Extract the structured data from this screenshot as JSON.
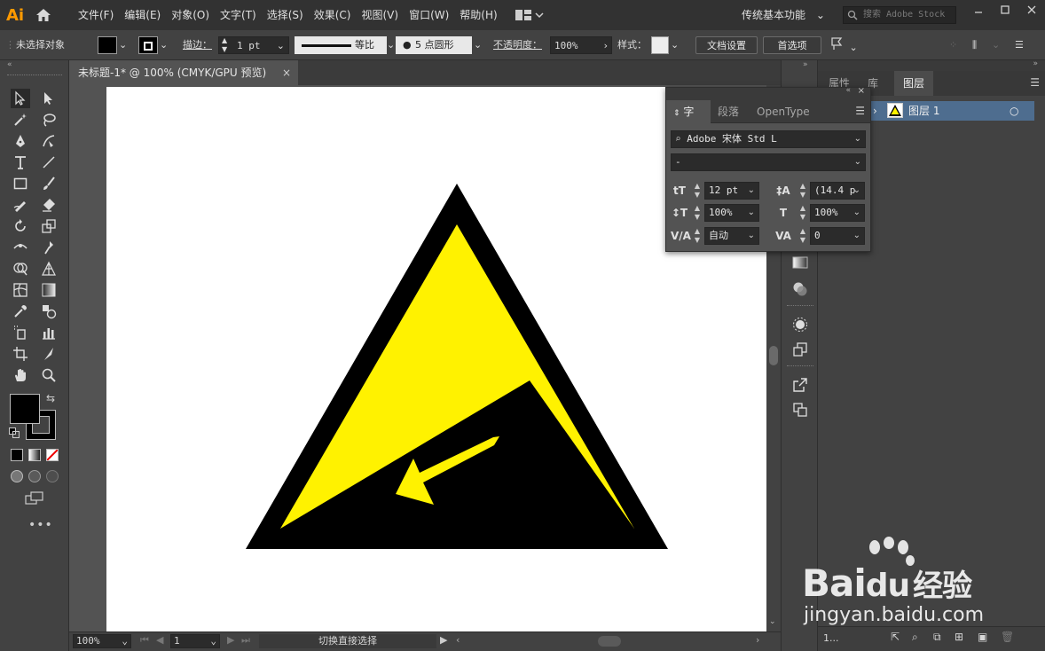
{
  "app": {
    "logo": "Ai",
    "icon_home": "home-icon"
  },
  "menu": [
    "文件(F)",
    "编辑(E)",
    "对象(O)",
    "文字(T)",
    "选择(S)",
    "效果(C)",
    "视图(V)",
    "窗口(W)",
    "帮助(H)"
  ],
  "workspace": {
    "label": "传统基本功能"
  },
  "search": {
    "placeholder": "搜索 Adobe Stock"
  },
  "controlbar": {
    "selection_status": "未选择对象",
    "stroke_label": "描边：",
    "stroke_weight": "1 pt",
    "stroke_profile": "等比",
    "brush": "5 点圆形",
    "opacity_label": "不透明度：",
    "opacity_value": "100%",
    "style_label": "样式：",
    "doc_setup_button": "文档设置",
    "preferences_button": "首选项"
  },
  "document": {
    "tab_title": "未标题-1* @ 100% (CMYK/GPU 预览)",
    "close_glyph": "×"
  },
  "statusbar": {
    "zoom": "100%",
    "page": "1",
    "tool_status": "切换直接选择"
  },
  "character_panel": {
    "tabs": [
      "字符",
      "段落",
      "OpenType"
    ],
    "font_family": "Adobe 宋体 Std L",
    "font_style": "-",
    "font_size": "12 pt",
    "leading": "(14.4 p",
    "vertical_scale": "100%",
    "horizontal_scale": "100%",
    "kerning": "自动",
    "tracking": "0"
  },
  "layers_panel": {
    "tabs": [
      "属性",
      "库",
      "图层"
    ],
    "layer_name": "图层 1",
    "count": "1..."
  },
  "watermark": {
    "brand": "Bai",
    "brand2": "du",
    "brand_cn": "经验",
    "url": "jingyan.baidu.com"
  },
  "colors": {
    "sign_yellow": "#fff200",
    "sign_black": "#000000",
    "ai_orange": "#ff9a00",
    "selected_layer": "#4e6d8f"
  }
}
